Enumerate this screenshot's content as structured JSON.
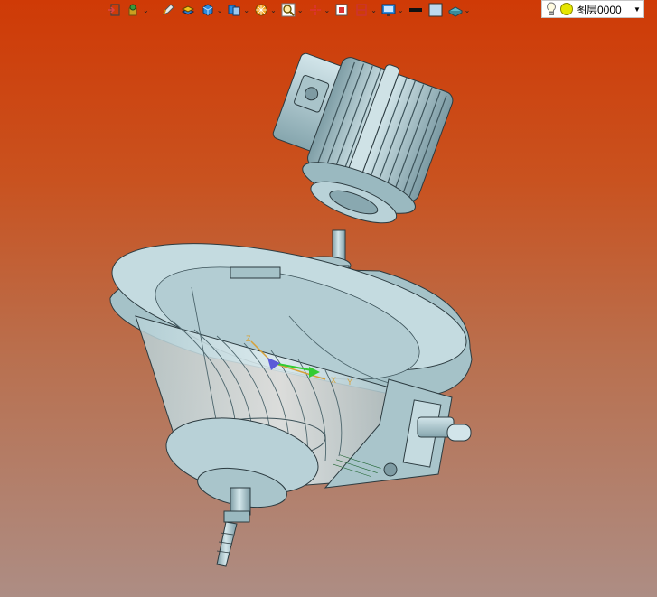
{
  "toolbar": {
    "items": [
      {
        "icon": "exit-icon",
        "dropdown": false
      },
      {
        "icon": "assembly-icon",
        "dropdown": true
      },
      {
        "icon": "pen-icon",
        "dropdown": false
      },
      {
        "icon": "layers-icon",
        "dropdown": false
      },
      {
        "icon": "cube-icon",
        "dropdown": true
      },
      {
        "icon": "multi-view-icon",
        "dropdown": true
      },
      {
        "icon": "render-mode-icon",
        "dropdown": true
      },
      {
        "icon": "zoom-icon",
        "dropdown": true
      },
      {
        "icon": "crosshair-icon",
        "dropdown": true
      },
      {
        "icon": "fit-view-icon",
        "dropdown": false
      },
      {
        "icon": "section-icon",
        "dropdown": true
      },
      {
        "icon": "display-icon",
        "dropdown": true
      },
      {
        "icon": "line-color-icon",
        "dropdown": false
      },
      {
        "icon": "fill-color-icon",
        "dropdown": false
      },
      {
        "icon": "plane-icon",
        "dropdown": true
      }
    ],
    "dropdown_glyph": "⌄"
  },
  "layer_selector": {
    "value": "图层0000",
    "arrow": "▼"
  },
  "triad": {
    "x": "X",
    "y": "Y",
    "z": "Z"
  },
  "model": {
    "name": "motor-pump-assembly",
    "colors": {
      "metal_light": "#c2d9de",
      "metal_mid": "#98b7bf",
      "metal_dark": "#5e7b84",
      "edge": "#2c3b40",
      "background_top": "#cf3a06",
      "background_bottom": "#ad8d84"
    }
  }
}
